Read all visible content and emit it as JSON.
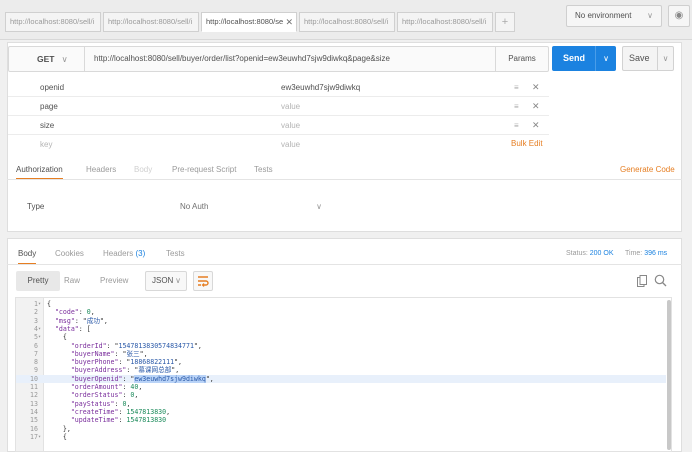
{
  "tabs": [
    {
      "label": "http://localhost:8080/sell/i",
      "active": false
    },
    {
      "label": "http://localhost:8080/sell/i",
      "active": false
    },
    {
      "label": "http://localhost:8080/se",
      "active": true
    },
    {
      "label": "http://localhost:8080/sell/i",
      "active": false
    },
    {
      "label": "http://localhost:8080/sell/i",
      "active": false
    }
  ],
  "new_tab_symbol": "+",
  "environment": {
    "label": "No environment"
  },
  "request": {
    "method": "GET",
    "url": "http://localhost:8080/sell/buyer/order/list?openid=ew3euwhd7sjw9diwkq&page&size",
    "params_label": "Params",
    "send_label": "Send",
    "save_label": "Save"
  },
  "params": [
    {
      "key": "openid",
      "value": "ew3euwhd7sjw9diwkq",
      "value_placeholder": false
    },
    {
      "key": "page",
      "value": "value",
      "value_placeholder": true
    },
    {
      "key": "size",
      "value": "value",
      "value_placeholder": true
    },
    {
      "key": "key",
      "value": "value",
      "value_placeholder": true,
      "key_placeholder": true
    }
  ],
  "bulk_edit": "Bulk Edit",
  "request_tabs": [
    {
      "label": "Authorization",
      "state": "active"
    },
    {
      "label": "Headers",
      "state": "normal"
    },
    {
      "label": "Body",
      "state": "disabled"
    },
    {
      "label": "Pre-request Script",
      "state": "normal"
    },
    {
      "label": "Tests",
      "state": "normal"
    }
  ],
  "generate_code": "Generate Code",
  "auth": {
    "type_label": "Type",
    "value": "No Auth"
  },
  "response": {
    "tabs": [
      {
        "label": "Body",
        "active": true
      },
      {
        "label": "Cookies",
        "active": false
      },
      {
        "label": "Headers",
        "count": "(3)",
        "active": false
      },
      {
        "label": "Tests",
        "active": false
      }
    ],
    "status_label": "Status:",
    "status_value": "200 OK",
    "time_label": "Time:",
    "time_value": "396 ms",
    "view_modes": [
      "Pretty",
      "Raw",
      "Preview"
    ],
    "format": "JSON"
  },
  "code_lines": [
    {
      "n": "1",
      "fold": true,
      "text": "{"
    },
    {
      "n": "2",
      "fold": false,
      "text": "  \"code\": 0,"
    },
    {
      "n": "3",
      "fold": false,
      "text": "  \"msg\": \"成功\","
    },
    {
      "n": "4",
      "fold": true,
      "text": "  \"data\": ["
    },
    {
      "n": "5",
      "fold": true,
      "text": "    {"
    },
    {
      "n": "6",
      "fold": false,
      "text": "      \"orderId\": \"1547813830574834771\","
    },
    {
      "n": "7",
      "fold": false,
      "text": "      \"buyerName\": \"张三\","
    },
    {
      "n": "8",
      "fold": false,
      "text": "      \"buyerPhone\": \"18868822111\","
    },
    {
      "n": "9",
      "fold": false,
      "text": "      \"buyerAddress\": \"慕课网总部\","
    },
    {
      "n": "10",
      "fold": false,
      "text": "      \"buyerOpenid\": \"ew3euwhd7sjw9diwkq\",",
      "highlight": true
    },
    {
      "n": "11",
      "fold": false,
      "text": "      \"orderAmount\": 40,"
    },
    {
      "n": "12",
      "fold": false,
      "text": "      \"orderStatus\": 0,"
    },
    {
      "n": "13",
      "fold": false,
      "text": "      \"payStatus\": 0,"
    },
    {
      "n": "14",
      "fold": false,
      "text": "      \"createTime\": 1547813830,"
    },
    {
      "n": "15",
      "fold": false,
      "text": "      \"updateTime\": 1547813830"
    },
    {
      "n": "16",
      "fold": false,
      "text": "    },"
    },
    {
      "n": "17",
      "fold": true,
      "text": "    {"
    }
  ],
  "colors": {
    "accent_orange": "#e67e22",
    "send_blue": "#1b82e0"
  },
  "icons": [
    "close-icon",
    "chevron-down-icon",
    "eye-icon",
    "menu-icon",
    "delete-icon",
    "wrap-icon",
    "copy-icon",
    "search-icon",
    "fold-arrow-icon"
  ]
}
